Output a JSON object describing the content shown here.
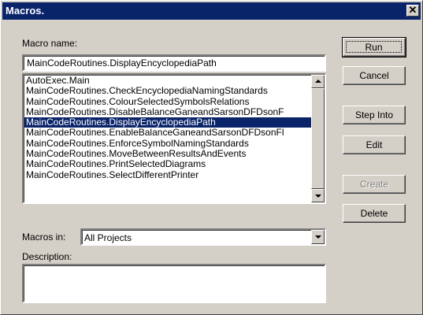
{
  "window": {
    "title": "Macros.",
    "close_glyph": "✕"
  },
  "macro_name": {
    "label": "Macro name:",
    "value": "MainCodeRoutines.DisplayEncyclopediaPath"
  },
  "macro_list": {
    "items": [
      "AutoExec.Main",
      "MainCodeRoutines.CheckEncyclopediaNamingStandards",
      "MainCodeRoutines.ColourSelectedSymbolsRelations",
      "MainCodeRoutines.DisableBalanceGaneandSarsonDFDsonF",
      "MainCodeRoutines.DisplayEncyclopediaPath",
      "MainCodeRoutines.EnableBalanceGaneandSarsonDFDsonFl",
      "MainCodeRoutines.EnforceSymbolNamingStandards",
      "MainCodeRoutines.MoveBetweenResultsAndEvents",
      "MainCodeRoutines.PrintSelectedDiagrams",
      "MainCodeRoutines.SelectDifferentPrinter"
    ],
    "selected_index": 4
  },
  "macros_in": {
    "label": "Macros in:",
    "value": "All Projects"
  },
  "description": {
    "label": "Description:",
    "value": ""
  },
  "buttons": {
    "run": "Run",
    "cancel": "Cancel",
    "step_into": "Step Into",
    "edit": "Edit",
    "create": "Create",
    "delete": "Delete"
  },
  "colors": {
    "face": "#d4d0c8",
    "titlebar": "#0a246a",
    "selection": "#0a246a"
  },
  "icons": {
    "close": "close-icon",
    "scroll_up": "arrow-up-icon",
    "scroll_down": "arrow-down-icon",
    "dropdown": "chevron-down-icon"
  }
}
